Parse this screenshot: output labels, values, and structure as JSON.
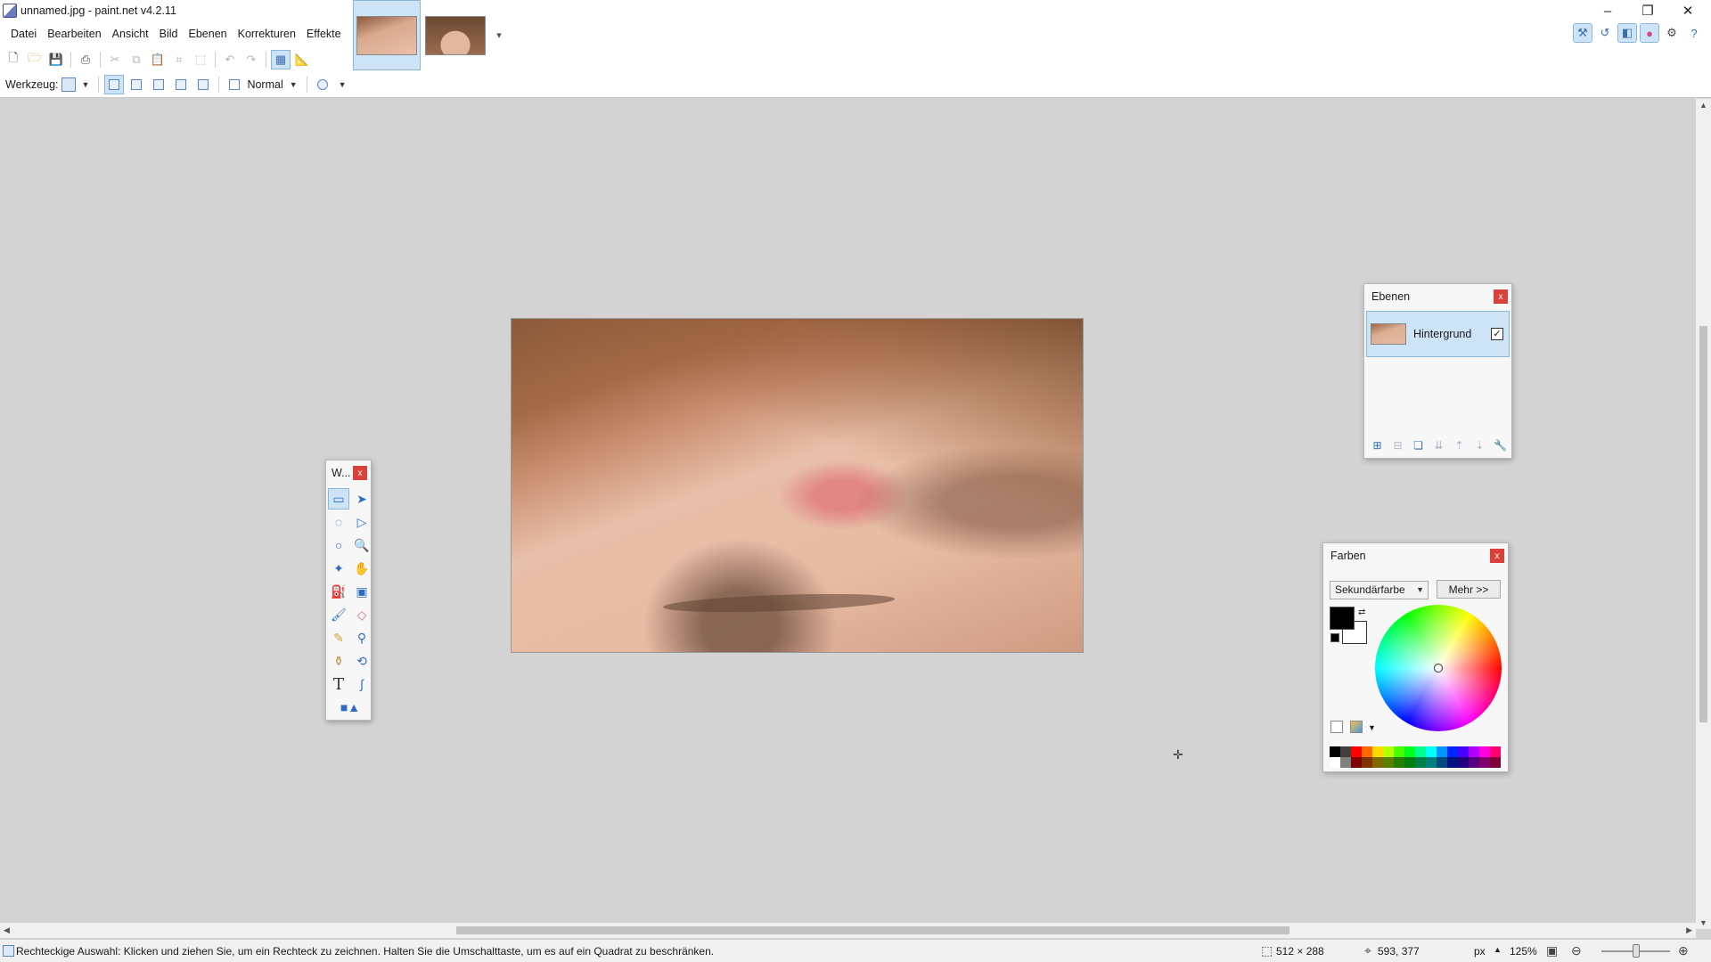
{
  "window": {
    "title": "unnamed.jpg - paint.net v4.2.11",
    "minimize_glyph": "–",
    "restore_glyph": "❐",
    "close_glyph": "✕"
  },
  "menu": [
    "Datei",
    "Bearbeiten",
    "Ansicht",
    "Bild",
    "Ebenen",
    "Korrekturen",
    "Effekte"
  ],
  "toolbar": {
    "tool_label": "Werkzeug:",
    "blend_mode": "Normal"
  },
  "tools_panel": {
    "title": "W...",
    "close": "x"
  },
  "layers_panel": {
    "title": "Ebenen",
    "close": "x",
    "layer_name": "Hintergrund",
    "layer_visible": "✓"
  },
  "colors_panel": {
    "title": "Farben",
    "close": "x",
    "selected_color": "Sekundärfarbe",
    "more_button": "Mehr >>",
    "primary_color": "#000000",
    "secondary_color": "#ffffff",
    "palette_top": [
      "#000000",
      "#404040",
      "#ff0000",
      "#ff6a00",
      "#ffd800",
      "#b6ff00",
      "#4cff00",
      "#00ff21",
      "#00ff90",
      "#00ffff",
      "#0094ff",
      "#0026ff",
      "#4800ff",
      "#b200ff",
      "#ff00dc",
      "#ff006e"
    ],
    "palette_bottom": [
      "#ffffff",
      "#808080",
      "#7f0000",
      "#7f3300",
      "#7f6a00",
      "#5b7f00",
      "#267f00",
      "#007f0e",
      "#007f46",
      "#007f7f",
      "#004a7f",
      "#00137f",
      "#21007f",
      "#57007f",
      "#7f006e",
      "#7f0037"
    ]
  },
  "status": {
    "hint": "Rechteckige Auswahl: Klicken und ziehen Sie, um ein Rechteck zu zeichnen. Halten Sie die Umschalttaste, um es auf ein Quadrat zu beschränken.",
    "selection_size": "512 × 288",
    "cursor_position": "593, 377",
    "unit": "px",
    "zoom": "125%"
  },
  "accent_color": "#cde4f7"
}
